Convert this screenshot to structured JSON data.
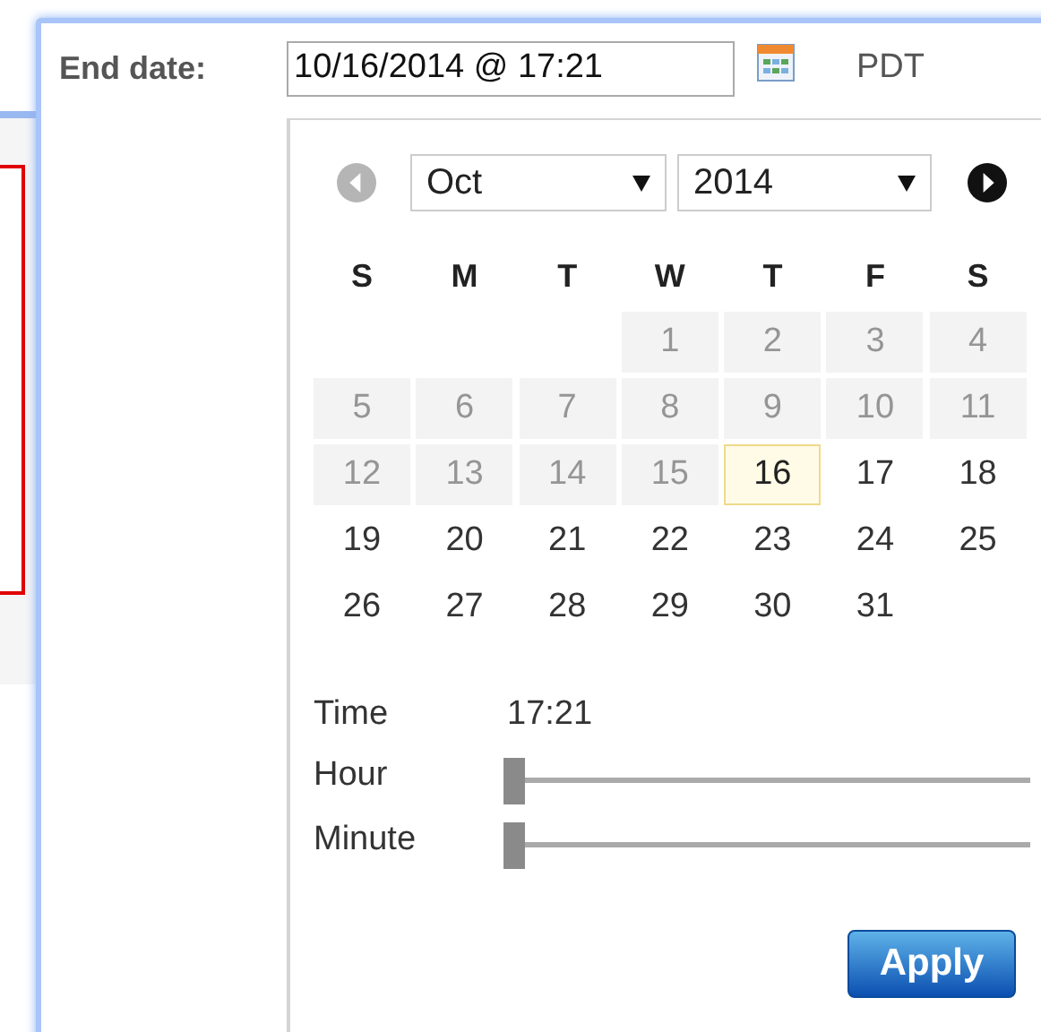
{
  "field": {
    "label": "End date:",
    "value": "10/16/2014 @ 17:21",
    "timezone": "PDT"
  },
  "calendar": {
    "month": "Oct",
    "year": "2014",
    "prev_disabled": true,
    "weekdays": [
      "S",
      "M",
      "T",
      "W",
      "T",
      "F",
      "S"
    ],
    "weeks": [
      [
        {
          "label": "1",
          "disabled": true,
          "selected": false
        },
        {
          "label": "2",
          "disabled": true,
          "selected": false
        },
        {
          "label": "3",
          "disabled": true,
          "selected": false
        },
        {
          "label": "4",
          "disabled": true,
          "selected": false
        }
      ],
      [
        {
          "label": "5",
          "disabled": true,
          "selected": false
        },
        {
          "label": "6",
          "disabled": true,
          "selected": false
        },
        {
          "label": "7",
          "disabled": true,
          "selected": false
        },
        {
          "label": "8",
          "disabled": true,
          "selected": false
        },
        {
          "label": "9",
          "disabled": true,
          "selected": false
        },
        {
          "label": "10",
          "disabled": true,
          "selected": false
        },
        {
          "label": "11",
          "disabled": true,
          "selected": false
        }
      ],
      [
        {
          "label": "12",
          "disabled": true,
          "selected": false
        },
        {
          "label": "13",
          "disabled": true,
          "selected": false
        },
        {
          "label": "14",
          "disabled": true,
          "selected": false
        },
        {
          "label": "15",
          "disabled": true,
          "selected": false
        },
        {
          "label": "16",
          "disabled": false,
          "selected": true
        },
        {
          "label": "17",
          "disabled": false,
          "selected": false
        },
        {
          "label": "18",
          "disabled": false,
          "selected": false
        }
      ],
      [
        {
          "label": "19",
          "disabled": false,
          "selected": false
        },
        {
          "label": "20",
          "disabled": false,
          "selected": false
        },
        {
          "label": "21",
          "disabled": false,
          "selected": false
        },
        {
          "label": "22",
          "disabled": false,
          "selected": false
        },
        {
          "label": "23",
          "disabled": false,
          "selected": false
        },
        {
          "label": "24",
          "disabled": false,
          "selected": false
        },
        {
          "label": "25",
          "disabled": false,
          "selected": false
        }
      ],
      [
        {
          "label": "26",
          "disabled": false,
          "selected": false
        },
        {
          "label": "27",
          "disabled": false,
          "selected": false
        },
        {
          "label": "28",
          "disabled": false,
          "selected": false
        },
        {
          "label": "29",
          "disabled": false,
          "selected": false
        },
        {
          "label": "30",
          "disabled": false,
          "selected": false
        },
        {
          "label": "31",
          "disabled": false,
          "selected": false
        }
      ]
    ],
    "time": {
      "label": "Time",
      "value": "17:21"
    },
    "sliders": [
      {
        "label": "Hour",
        "level": 0
      },
      {
        "label": "Minute",
        "level": 0
      }
    ],
    "apply": "Apply"
  }
}
